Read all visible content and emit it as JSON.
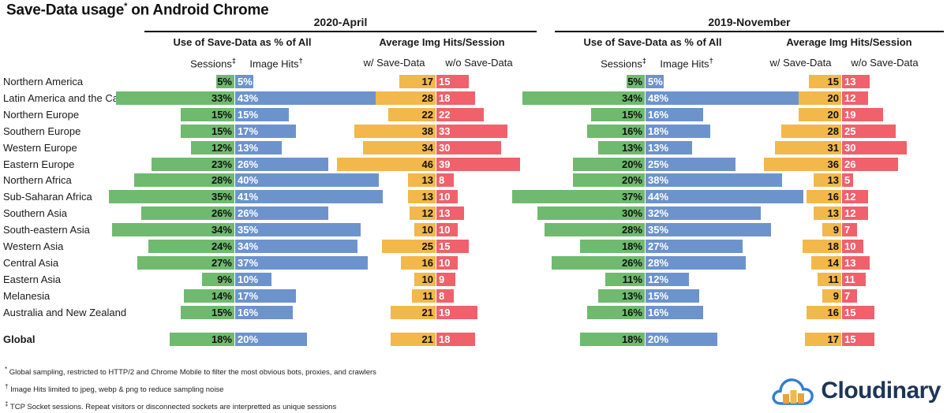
{
  "title": "Save-Data usage",
  "title_sup": "*",
  "title_rest": " on Android Chrome",
  "colors": {
    "green": "#6fba6f",
    "blue": "#6d93cc",
    "orange": "#f2b84b",
    "red": "#f0616b",
    "logo_cloud": "#2f7fd1",
    "logo_text": "#1d3557"
  },
  "periods": [
    {
      "label": "2020-April"
    },
    {
      "label": "2019-November"
    }
  ],
  "group_headers": {
    "savedata_pct": "Use of Save-Data as % of All",
    "avg_hits": "Average Img Hits/Session"
  },
  "sub_headers": {
    "sessions": "Sessions",
    "sessions_sup": "‡",
    "image_hits": "Image Hits",
    "image_hits_sup": "†",
    "with_savedata": "w/  Save-Data",
    "without_savedata": "w/o Save-Data"
  },
  "regions": [
    "Northern America",
    "Latin America and the Caribbe",
    "Northern Europe",
    "Southern Europe",
    "Western Europe",
    "Eastern Europe",
    "Northern Africa",
    "Sub-Saharan Africa",
    "Southern Asia",
    "South-eastern Asia",
    "Western Asia",
    "Central Asia",
    "Eastern Asia",
    "Melanesia",
    "Australia and New Zealand"
  ],
  "global_label": "Global",
  "footnotes": [
    {
      "sup": "*",
      "text": "Global sampling, restricted to HTTP/2 and Chrome Mobile to filter the most obvious bots, proxies, and crawlers"
    },
    {
      "sup": "†",
      "text": "Image Hits limited to jpeg, webp & png to reduce sampling noise"
    },
    {
      "sup": "‡",
      "text": "TCP Socket sessions. Repeat visitors or disconnected sockets are interpretted as unique sessions"
    }
  ],
  "logo": {
    "name": "Cloudinary"
  },
  "chart_data": {
    "type": "bar",
    "title": "Save-Data usage* on Android Chrome",
    "layout": "diverging paired horizontal bars, 4 panels (2 periods x 2 metrics)",
    "categories": [
      "Northern America",
      "Latin America and the Caribbe",
      "Northern Europe",
      "Southern Europe",
      "Western Europe",
      "Eastern Europe",
      "Northern Africa",
      "Sub-Saharan Africa",
      "Southern Asia",
      "South-eastern Asia",
      "Western Asia",
      "Central Asia",
      "Eastern Asia",
      "Melanesia",
      "Australia and New Zealand",
      "Global"
    ],
    "panels": [
      {
        "period": "2020-April",
        "metric": "Use of Save-Data as % of All",
        "unit": "%",
        "series": [
          {
            "name": "Sessions",
            "side": "left",
            "color": "#6fba6f",
            "values": [
              5,
              33,
              15,
              15,
              12,
              23,
              28,
              35,
              26,
              34,
              24,
              27,
              9,
              14,
              15,
              18
            ]
          },
          {
            "name": "Image Hits",
            "side": "right",
            "color": "#6d93cc",
            "values": [
              5,
              43,
              15,
              17,
              13,
              26,
              40,
              41,
              26,
              35,
              34,
              37,
              10,
              17,
              16,
              20
            ]
          }
        ]
      },
      {
        "period": "2020-April",
        "metric": "Average Img Hits/Session",
        "unit": "",
        "series": [
          {
            "name": "w/ Save-Data",
            "side": "left",
            "color": "#f2b84b",
            "values": [
              17,
              28,
              22,
              38,
              34,
              46,
              13,
              13,
              12,
              10,
              25,
              16,
              10,
              11,
              21,
              21
            ]
          },
          {
            "name": "w/o Save-Data",
            "side": "right",
            "color": "#f0616b",
            "values": [
              15,
              18,
              22,
              33,
              30,
              39,
              8,
              10,
              13,
              10,
              15,
              10,
              9,
              8,
              19,
              18
            ]
          }
        ]
      },
      {
        "period": "2019-November",
        "metric": "Use of Save-Data as % of All",
        "unit": "%",
        "series": [
          {
            "name": "Sessions",
            "side": "left",
            "color": "#6fba6f",
            "values": [
              5,
              34,
              15,
              16,
              13,
              20,
              20,
              37,
              30,
              28,
              18,
              26,
              11,
              13,
              16,
              18
            ]
          },
          {
            "name": "Image Hits",
            "side": "right",
            "color": "#6d93cc",
            "values": [
              5,
              48,
              16,
              18,
              13,
              25,
              38,
              44,
              32,
              35,
              27,
              28,
              12,
              15,
              16,
              20
            ]
          }
        ]
      },
      {
        "period": "2019-November",
        "metric": "Average Img Hits/Session",
        "unit": "",
        "series": [
          {
            "name": "w/ Save-Data",
            "side": "left",
            "color": "#f2b84b",
            "values": [
              15,
              20,
              20,
              28,
              31,
              36,
              13,
              16,
              13,
              9,
              18,
              14,
              11,
              9,
              16,
              17
            ]
          },
          {
            "name": "w/o Save-Data",
            "side": "right",
            "color": "#f0616b",
            "values": [
              13,
              12,
              19,
              25,
              30,
              26,
              5,
              12,
              12,
              7,
              10,
              13,
              11,
              7,
              15,
              15
            ]
          }
        ]
      }
    ]
  }
}
